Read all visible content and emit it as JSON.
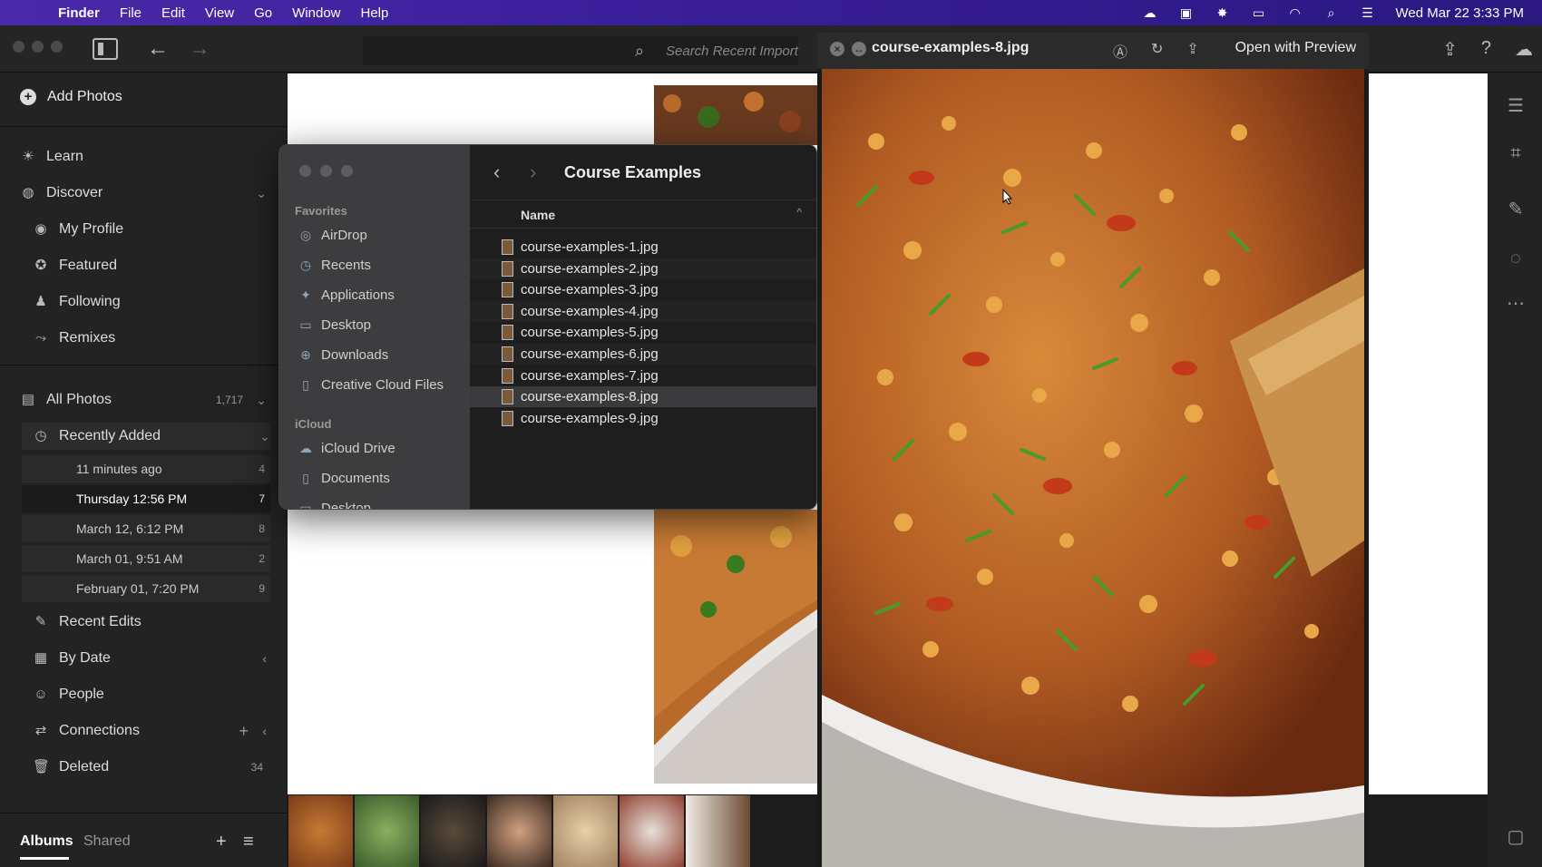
{
  "menubar": {
    "items": [
      "Finder",
      "File",
      "Edit",
      "View",
      "Go",
      "Window",
      "Help"
    ],
    "clock": "Wed Mar 22  3:33 PM"
  },
  "toolbar": {
    "search_placeholder": "Search Recent Import"
  },
  "sidebar": {
    "add_photos": "Add Photos",
    "learn": "Learn",
    "discover": "Discover",
    "discover_items": [
      "My Profile",
      "Featured",
      "Following",
      "Remixes"
    ],
    "all_photos": "All Photos",
    "all_photos_count": "1,717",
    "recently_added": "Recently Added",
    "recent_subitems": [
      {
        "label": "11 minutes ago",
        "count": "4"
      },
      {
        "label": "Thursday  12:56 PM",
        "count": "7"
      },
      {
        "label": "March 12, 6:12 PM",
        "count": "8"
      },
      {
        "label": "March 01, 9:51 AM",
        "count": "2"
      },
      {
        "label": "February 01, 7:20 PM",
        "count": "9"
      }
    ],
    "recent_edits": "Recent Edits",
    "by_date": "By Date",
    "people": "People",
    "connections": "Connections",
    "deleted": "Deleted",
    "deleted_count": "34",
    "albums_tab": "Albums",
    "shared_tab": "Shared"
  },
  "finder": {
    "title": "Course Examples",
    "favorites_header": "Favorites",
    "favorites": [
      "AirDrop",
      "Recents",
      "Applications",
      "Desktop",
      "Downloads",
      "Creative Cloud Files"
    ],
    "icloud_header": "iCloud",
    "icloud": [
      "iCloud Drive",
      "Documents",
      "Desktop"
    ],
    "column_name": "Name",
    "files": [
      "course-examples-1.jpg",
      "course-examples-2.jpg",
      "course-examples-3.jpg",
      "course-examples-4.jpg",
      "course-examples-5.jpg",
      "course-examples-6.jpg",
      "course-examples-7.jpg",
      "course-examples-8.jpg",
      "course-examples-9.jpg"
    ],
    "selected_index": 7
  },
  "quicklook": {
    "filename": "course-examples-8.jpg",
    "open_with": "Open with Preview"
  },
  "colors": {
    "menubar": "#3a1f9a",
    "sidebar": "#232323",
    "finder_side": "#3e3e42",
    "selection": "#3a3a3c"
  }
}
